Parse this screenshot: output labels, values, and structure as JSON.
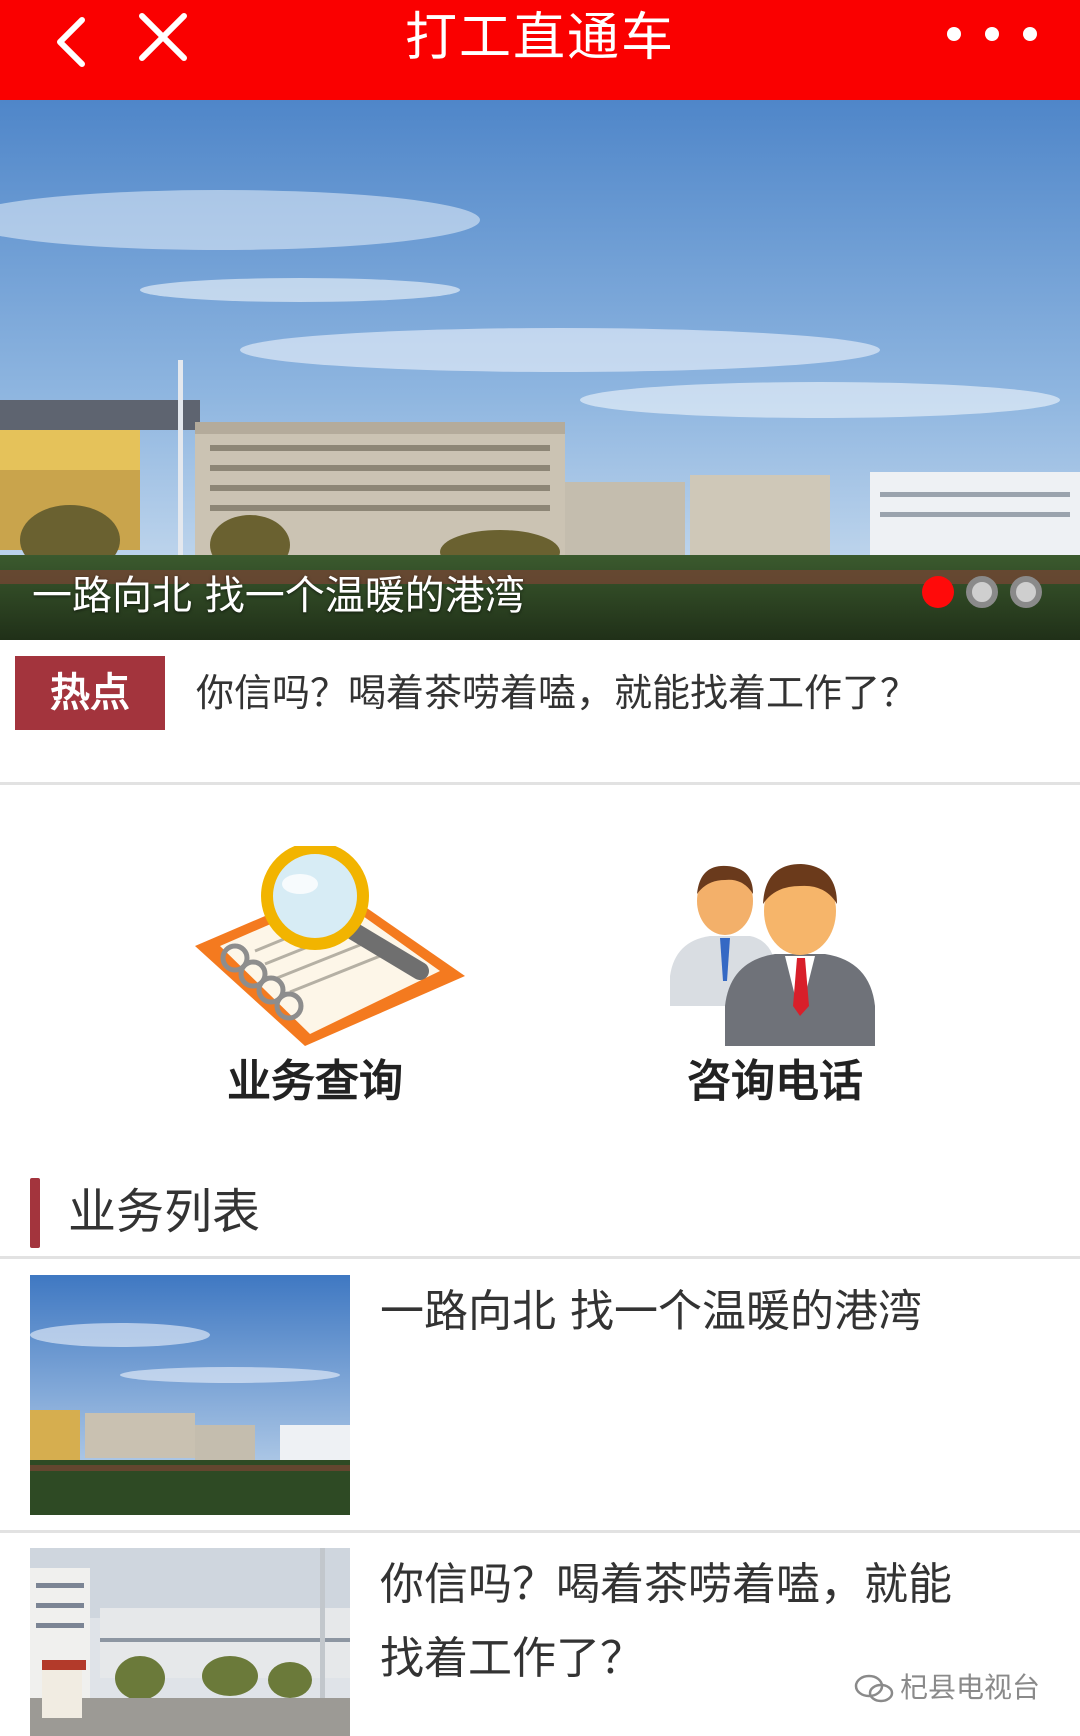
{
  "header": {
    "title": "打工直通车",
    "back_icon": "chevron-left-icon",
    "close_icon": "close-icon",
    "more_icon": "more-dots-icon",
    "color": "#fa0000"
  },
  "banner": {
    "caption": "一路向北 找一个温暖的港湾",
    "slides_total": 3,
    "active_slide": 1
  },
  "hot": {
    "badge": "热点",
    "text": "你信吗？喝着茶唠着嗑，就能找着工作了？",
    "badge_color": "#a3343d"
  },
  "shortcuts": [
    {
      "label": "业务查询",
      "icon": "magnifier-notebook-icon"
    },
    {
      "label": "咨询电话",
      "icon": "two-businessmen-icon"
    }
  ],
  "section": {
    "title": "业务列表"
  },
  "list": [
    {
      "title": "一路向北 找一个温暖的港湾"
    },
    {
      "title_line1": "你信吗？喝着茶唠着嗑，就能",
      "title_line2": "找着工作了？"
    }
  ],
  "watermark": {
    "text": "杞县电视台"
  }
}
